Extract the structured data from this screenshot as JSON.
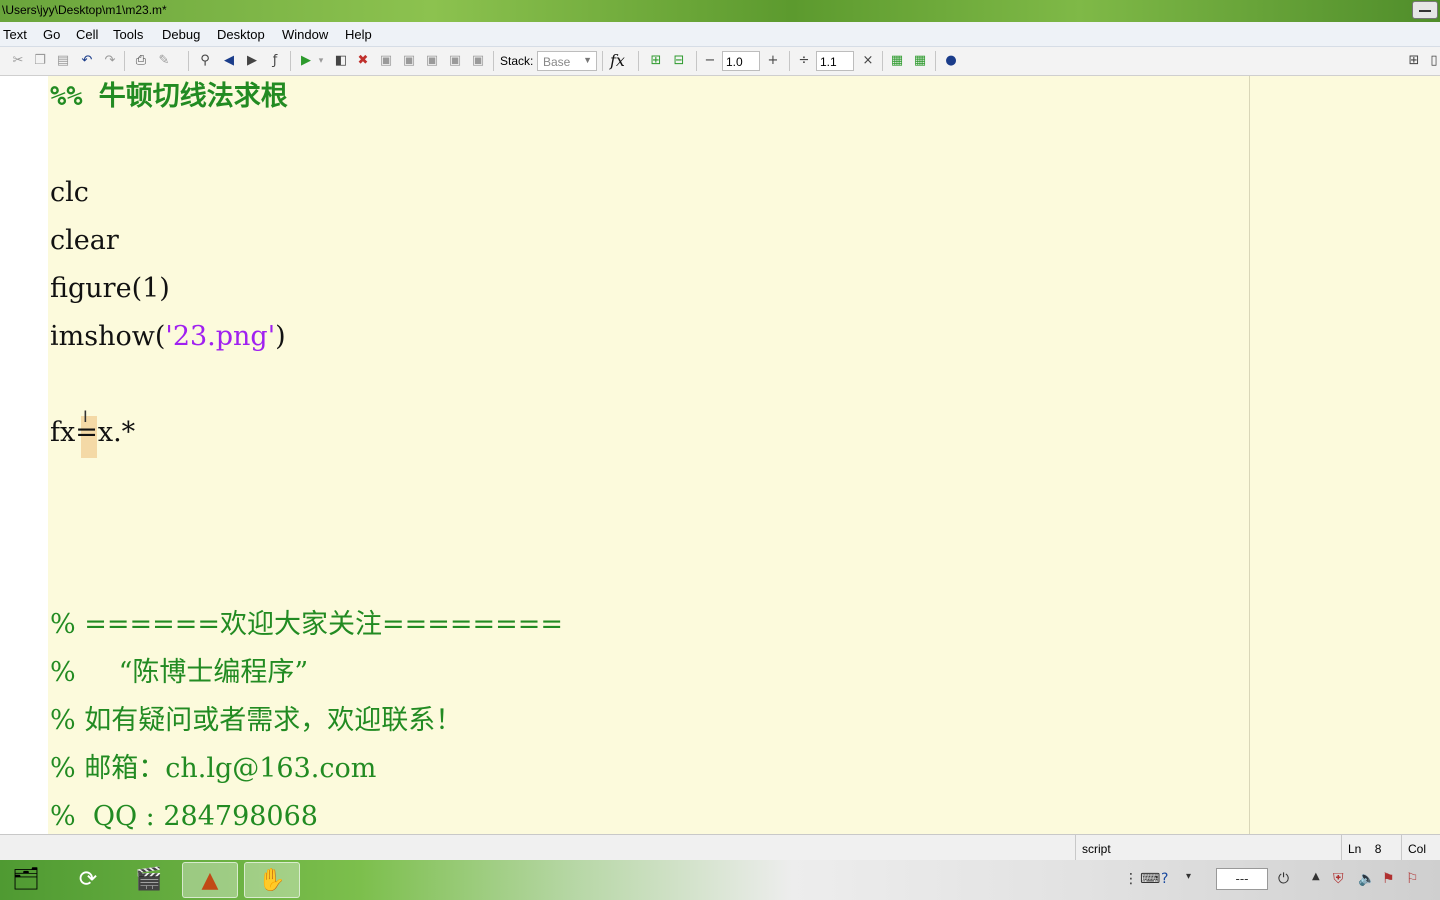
{
  "window": {
    "title": "\\Users\\jyy\\Desktop\\m1\\m23.m*"
  },
  "menu": [
    "Text",
    "Go",
    "Cell",
    "Tools",
    "Debug",
    "Desktop",
    "Window",
    "Help"
  ],
  "toolbar": {
    "stack_label": "Stack:",
    "stack_value": "Base",
    "fx_label": "fx",
    "minus_label": "−",
    "value1": "1.0",
    "plus_label": "+",
    "divide_label": "÷",
    "value2": "1.1",
    "times_label": "×"
  },
  "editor": {
    "lines": [
      {
        "type": "cell",
        "text": "%% 牛顿切线法求根"
      },
      {
        "type": "code",
        "text": "clc"
      },
      {
        "type": "code",
        "text": "clear"
      },
      {
        "type": "code",
        "text": "figure(1)"
      },
      {
        "type": "code_string",
        "before": "imshow(",
        "string": "'23.png'",
        "after": ")"
      },
      {
        "type": "code",
        "text": "fx=x.*"
      },
      {
        "type": "comment",
        "text": "% ======欢迎大家关注========"
      },
      {
        "type": "comment",
        "text": "%     “陈博士编程序”"
      },
      {
        "type": "comment",
        "text": "% 如有疑问或者需求，欢迎联系！"
      },
      {
        "type": "comment",
        "text": "% 邮箱：ch.lg@163.com"
      },
      {
        "type": "comment",
        "text": "%  QQ : 284798068"
      }
    ]
  },
  "status": {
    "mode": "script",
    "ln_label": "Ln",
    "ln_value": "8",
    "col_label": "Col"
  },
  "taskbar": {
    "clock": "---"
  },
  "colors": {
    "editor_bg": "#fcfadc",
    "comment": "#228b22",
    "string": "#a020f0"
  }
}
